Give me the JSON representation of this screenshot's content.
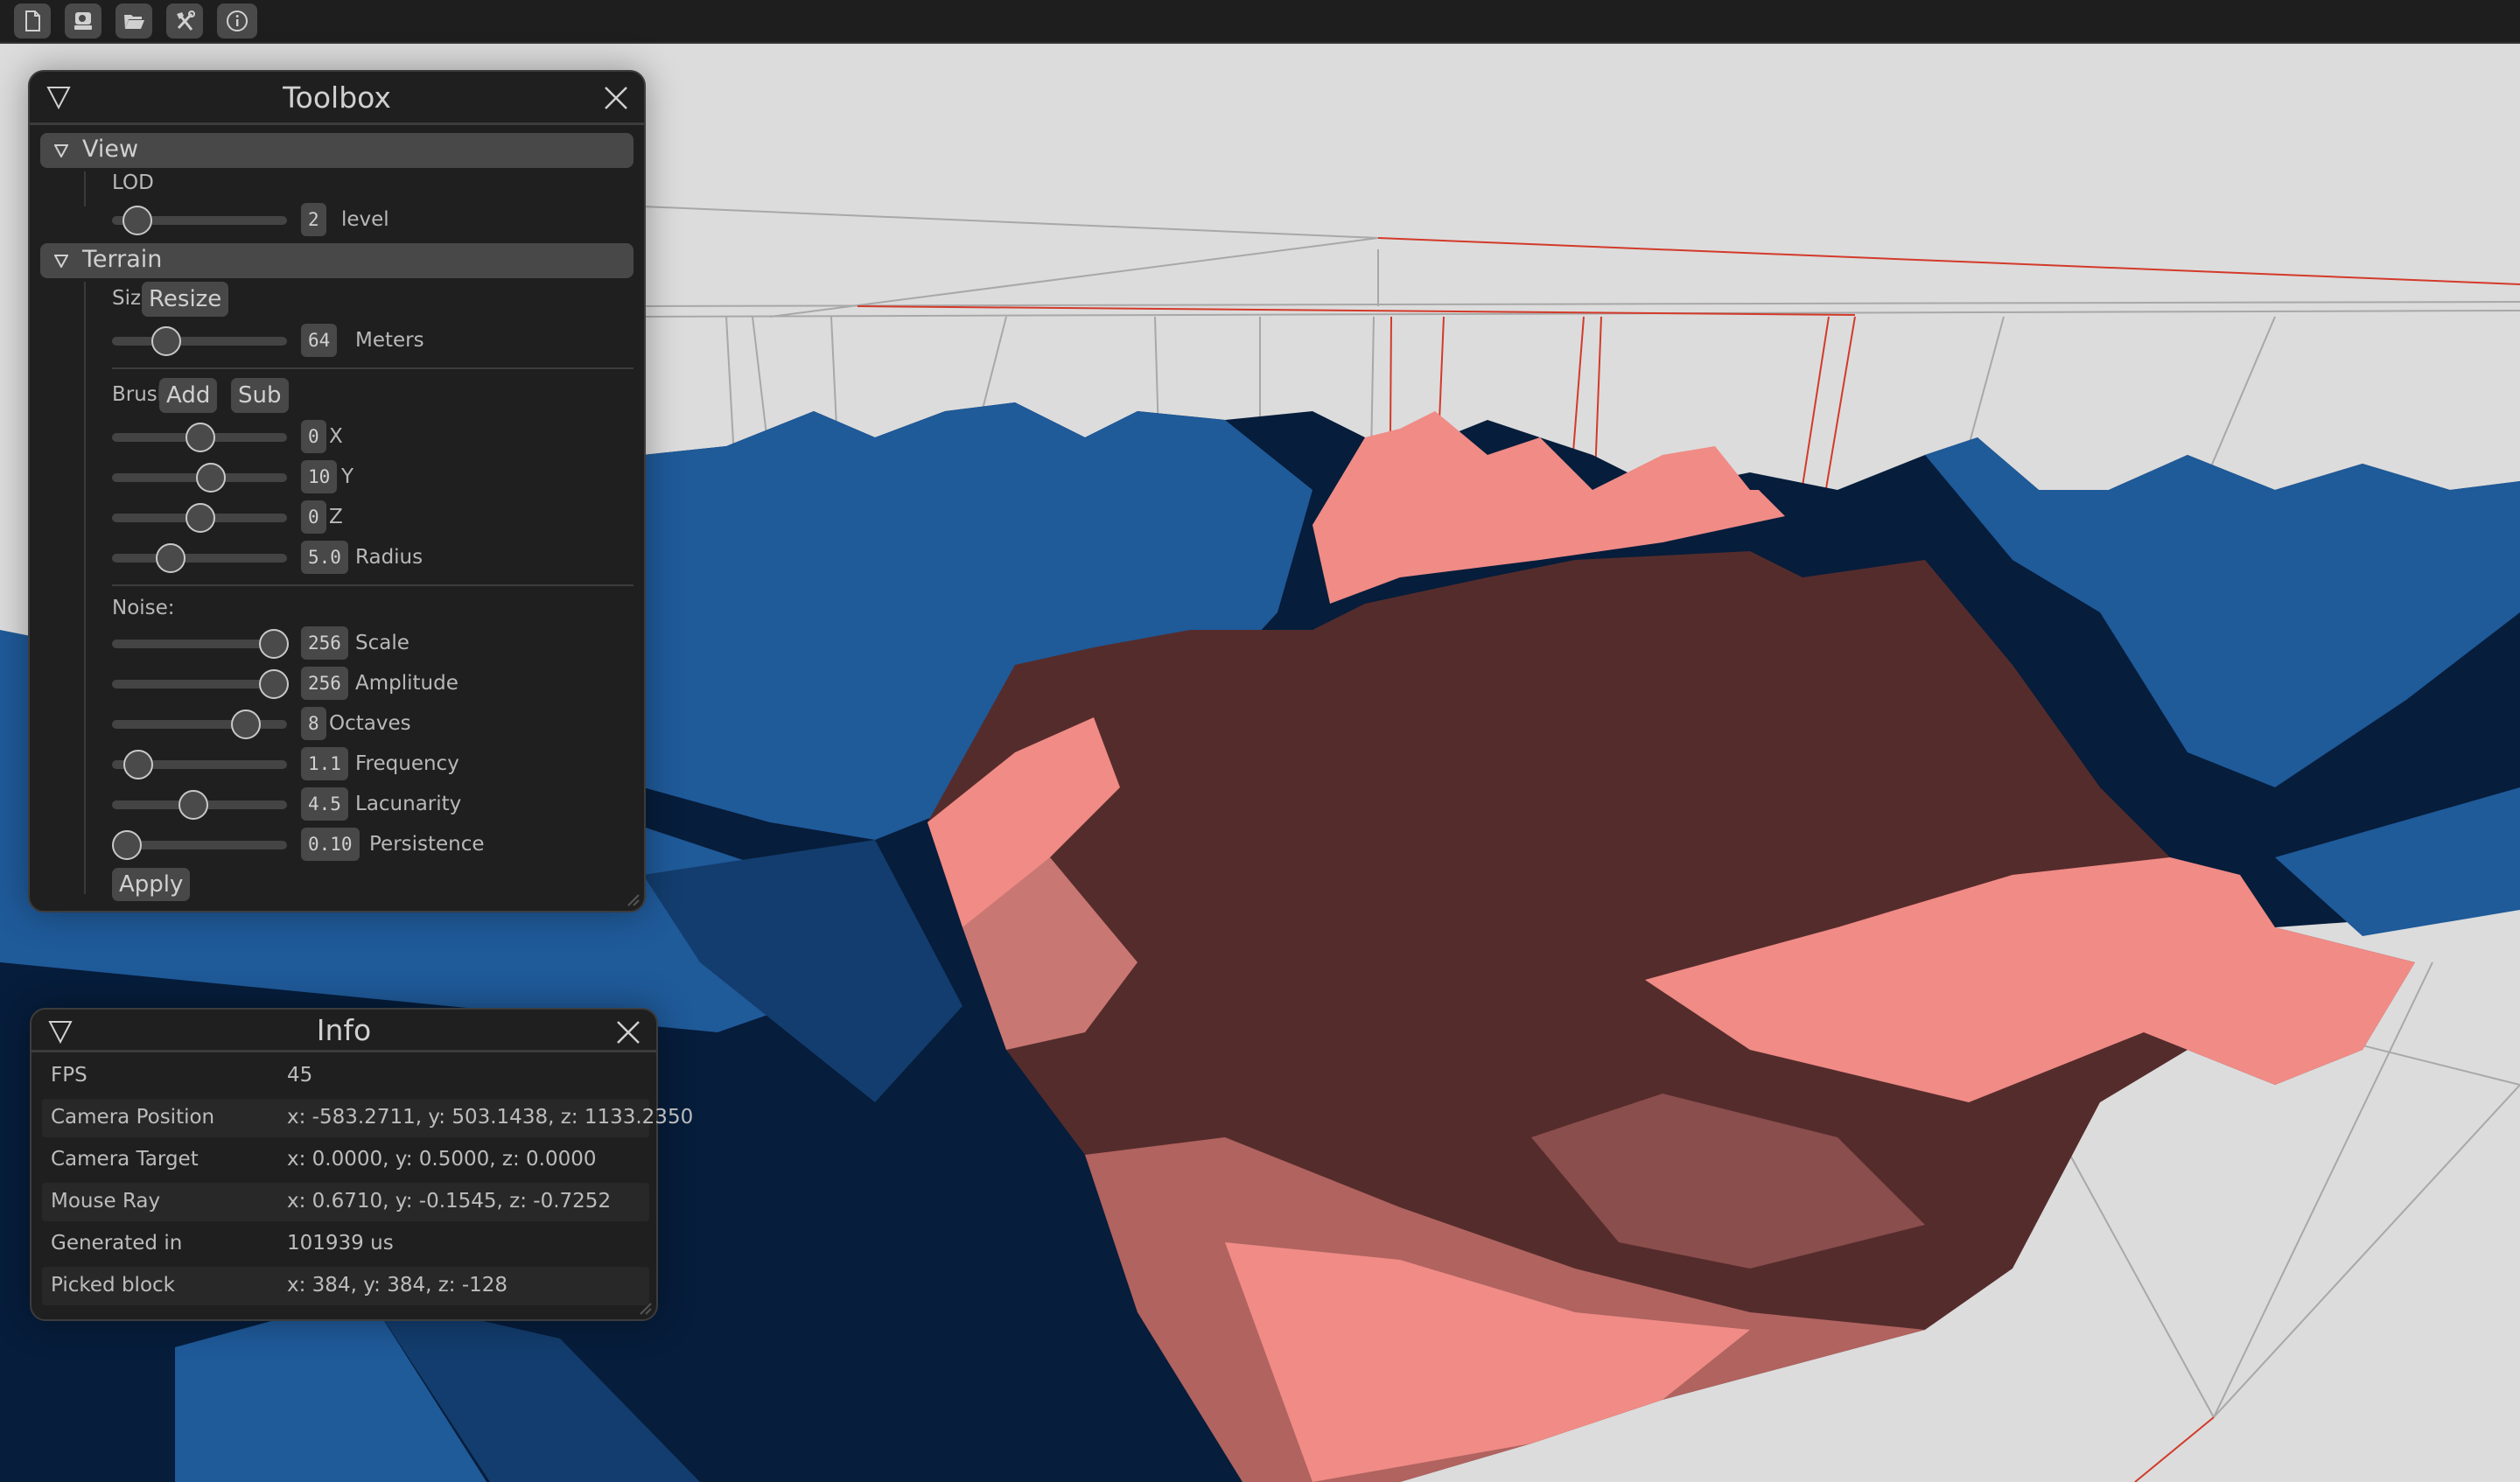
{
  "toolbar": {
    "buttons": [
      {
        "icon": "new-file-icon"
      },
      {
        "icon": "save-disk-icon"
      },
      {
        "icon": "open-folder-icon"
      },
      {
        "icon": "tools-icon"
      },
      {
        "icon": "info-icon"
      }
    ]
  },
  "scene": {
    "colors": {
      "sky": "#dcdcdc",
      "terrain_blue": "#1f5a99",
      "terrain_navy": "#061d3b",
      "selected_light": "#f08b86",
      "selected_dark": "#552c2c",
      "wire_gray": "#a8a8a8",
      "wire_red": "#d33a2a"
    }
  },
  "toolbox": {
    "title": "Toolbox",
    "view": {
      "header": "View",
      "lod_label": "LOD",
      "lod": {
        "value": "2",
        "unit": "level",
        "fraction": 0.07
      }
    },
    "terrain": {
      "header": "Terrain",
      "size_label": "Size:",
      "resize_button": "Resize",
      "size": {
        "value": "64",
        "unit": "Meters",
        "fraction": 0.27
      },
      "brush_label": "Brush:",
      "add_button": "Add",
      "sub_button": "Sub",
      "brush_sliders": [
        {
          "value": "0",
          "label": "X",
          "fraction": 0.5
        },
        {
          "value": "10",
          "label": "Y",
          "fraction": 0.57
        },
        {
          "value": "0",
          "label": "Z",
          "fraction": 0.5
        },
        {
          "value": "5.0",
          "label": "Radius",
          "fraction": 0.3
        }
      ],
      "noise_label": "Noise:",
      "noise_sliders": [
        {
          "value": "256",
          "label": "Scale",
          "fraction": 1.0
        },
        {
          "value": "256",
          "label": "Amplitude",
          "fraction": 1.0
        },
        {
          "value": "8",
          "label": "Octaves",
          "fraction": 0.81
        },
        {
          "value": "1.1",
          "label": "Frequency",
          "fraction": 0.08
        },
        {
          "value": "4.5",
          "label": "Lacunarity",
          "fraction": 0.45
        },
        {
          "value": "0.10",
          "label": "Persistence",
          "fraction": 0.0
        }
      ],
      "apply_button": "Apply"
    }
  },
  "info": {
    "title": "Info",
    "rows": [
      {
        "key": "FPS",
        "value": "45"
      },
      {
        "key": "Camera Position",
        "value": "x: -583.2711, y: 503.1438, z: 1133.2350"
      },
      {
        "key": "Camera Target",
        "value": "x: 0.0000, y: 0.5000, z: 0.0000"
      },
      {
        "key": "Mouse Ray",
        "value": "x: 0.6710, y: -0.1545, z: -0.7252"
      },
      {
        "key": "Generated in",
        "value": "101939 us"
      },
      {
        "key": "Picked block",
        "value": "x: 384, y: 384, z: -128"
      }
    ]
  }
}
